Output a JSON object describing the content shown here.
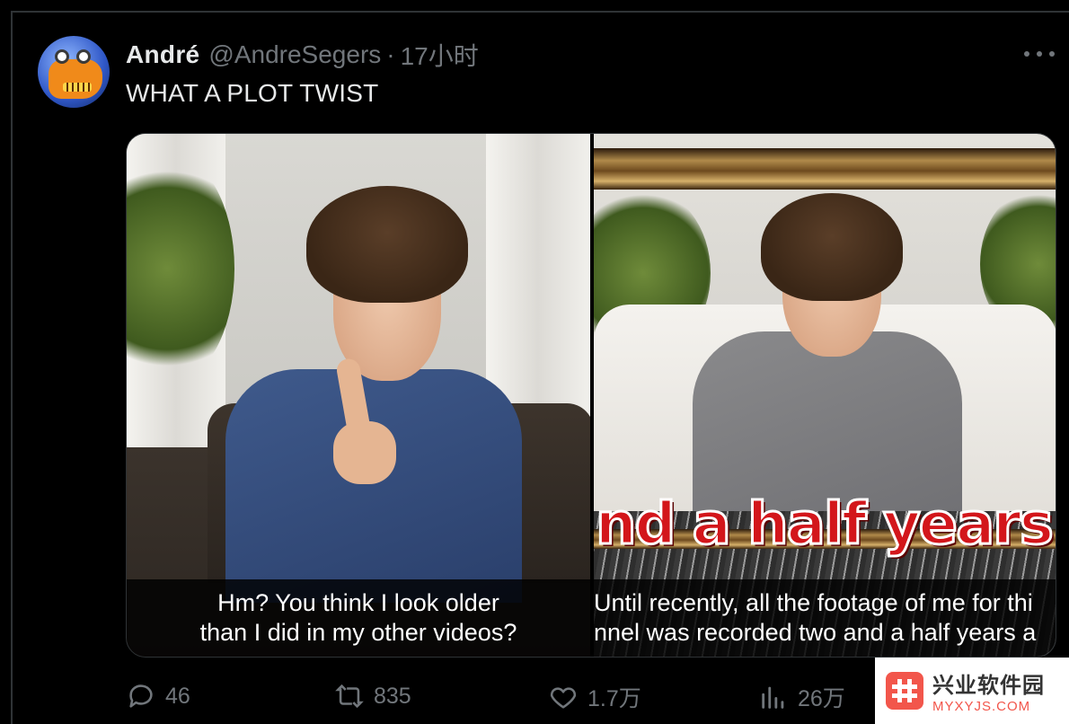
{
  "tweet": {
    "author_name": "André",
    "author_handle": "@AndreSegers",
    "separator": "·",
    "time_ago": "17小时",
    "text": "WHAT A PLOT TWIST",
    "avatar": "robot-avatar"
  },
  "media": {
    "left_subtitle_line1": "Hm? You think I look older",
    "left_subtitle_line2": "than I did in my other videos?",
    "right_big_caption": "nd a half years",
    "right_subtitle_line1": "Until recently, all the footage of me for thi",
    "right_subtitle_line2": "nnel was recorded two and a half years a"
  },
  "actions": {
    "reply_icon": "reply-icon",
    "reply_count": "46",
    "retweet_icon": "retweet-icon",
    "retweet_count": "835",
    "like_icon": "heart-icon",
    "like_count": "1.7万",
    "views_icon": "views-chart-icon",
    "views_count": "26万"
  },
  "watermark": {
    "title": "兴业软件园",
    "url": "MYXYJS.COM"
  },
  "colors": {
    "background": "#000000",
    "primary_text": "#e7e9ea",
    "secondary_text": "#71767b",
    "caption_red": "#d3161b",
    "watermark_red": "#f2564b"
  }
}
